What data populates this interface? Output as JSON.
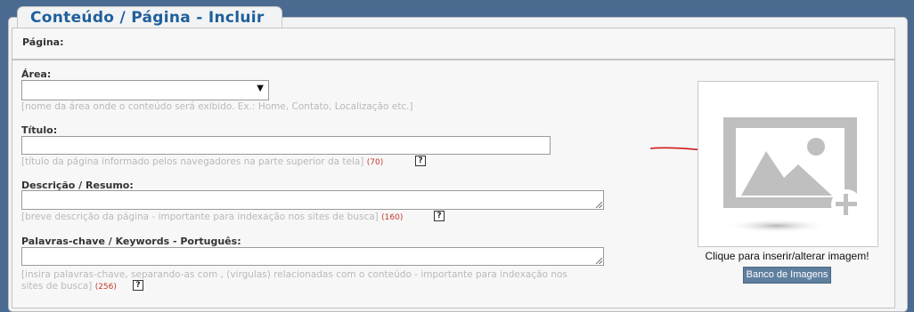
{
  "header": {
    "title": "Conteúdo / Página - Incluir"
  },
  "section": {
    "label": "Página:"
  },
  "form": {
    "area": {
      "label": "Área:",
      "value": "",
      "hint": "[nome da área onde o conteúdo será exibido. Ex.: Home, Contato, Localização etc.]"
    },
    "titulo": {
      "label": "Título:",
      "value": "",
      "hint": "[título da página informado pelos navegadores na parte superior da tela]",
      "limit": "(70)",
      "help": "?"
    },
    "descricao": {
      "label": "Descrição / Resumo:",
      "value": "",
      "hint": "[breve descrição da página - importante para indexação nos sites de busca]",
      "limit": "(160)",
      "help": "?"
    },
    "keywords": {
      "label": "Palavras-chave / Keywords - Português:",
      "value": "",
      "hint_line1": "[insira palavras-chave, separando-as com , (virgulas) relacionadas com o conteúdo - importante para indexação nos",
      "hint_line2": "sites de busca]",
      "limit": "(256)",
      "help": "?"
    }
  },
  "image": {
    "icon": "image-add-icon",
    "caption": "Clique para inserir/alterar imagem!",
    "bank_button": "Banco de Imagens"
  },
  "annotation": {
    "icon": "red-arrow-icon",
    "color": "#d11a1a"
  }
}
